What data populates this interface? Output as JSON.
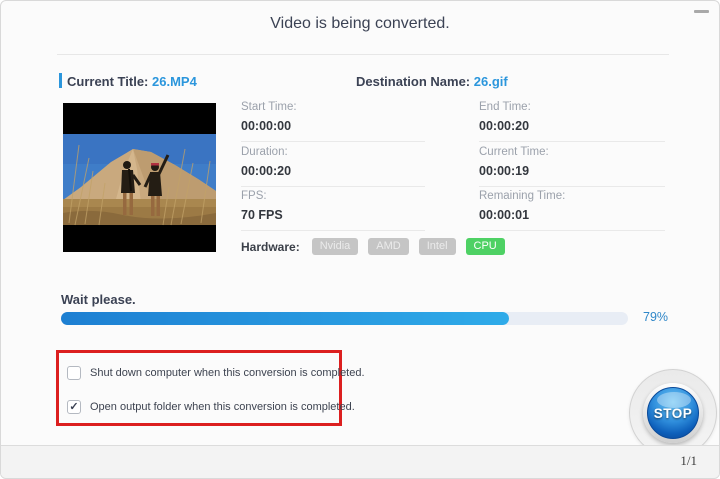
{
  "window": {
    "title": "Video is being converted."
  },
  "header": {
    "current_title_label": "Current Title: ",
    "current_title_value": "26.MP4",
    "destination_label": "Destination Name: ",
    "destination_value": "26.gif"
  },
  "info": {
    "left": [
      {
        "label": "Start Time:",
        "value": "00:00:00"
      },
      {
        "label": "Duration:",
        "value": "00:00:20"
      },
      {
        "label": "FPS:",
        "value": "70 FPS"
      }
    ],
    "right": [
      {
        "label": "End Time:",
        "value": "00:00:20"
      },
      {
        "label": "Current Time:",
        "value": "00:00:19"
      },
      {
        "label": "Remaining Time:",
        "value": "00:00:01"
      }
    ]
  },
  "hardware": {
    "label": "Hardware:",
    "options": [
      {
        "label": "Nvidia",
        "active": false
      },
      {
        "label": "AMD",
        "active": false
      },
      {
        "label": "Intel",
        "active": false
      },
      {
        "label": "CPU",
        "active": true
      }
    ]
  },
  "progress": {
    "status_text": "Wait please.",
    "percent": 79,
    "percent_label": "79%"
  },
  "options": [
    {
      "label": "Shut down computer when this conversion is completed.",
      "checked": false,
      "glyph": ""
    },
    {
      "label": "Open output folder when this conversion is completed.",
      "checked": true,
      "glyph": "✓"
    }
  ],
  "stop_button": {
    "label": "STOP"
  },
  "footer": {
    "page_indicator": "1/1"
  },
  "colors": {
    "accent_blue": "#2b96dc",
    "progress_start": "#1d7fd2",
    "progress_end": "#2fabe9",
    "cpu_active_green": "#4ed164",
    "highlight_red": "#dc1f1f"
  }
}
